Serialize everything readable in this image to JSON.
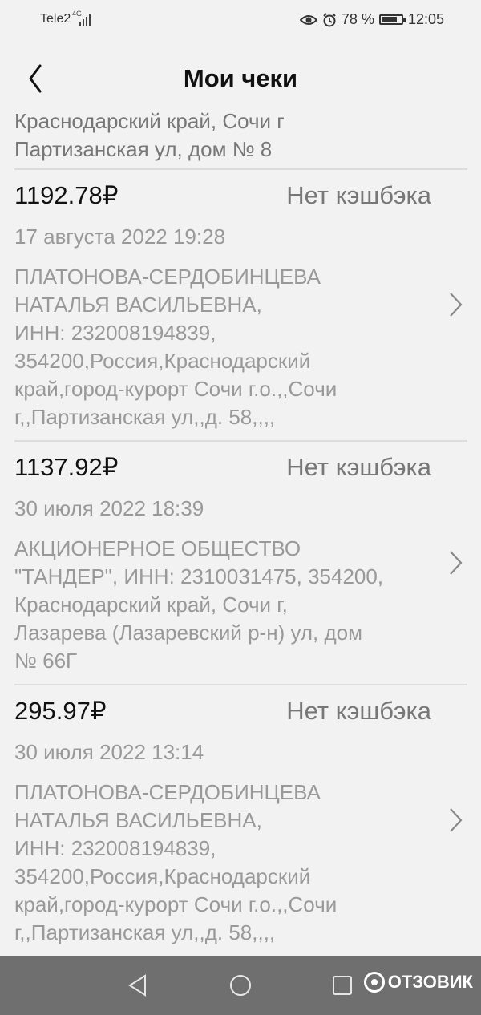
{
  "status_bar": {
    "carrier": "Tele2",
    "network": "4G",
    "battery": "78 %",
    "battery_level": 0.78,
    "time": "12:05"
  },
  "header": {
    "title": "Мои чеки"
  },
  "partial_top": "Краснодарский край, Сочи г\nПартизанская ул, дом № 8",
  "receipts": [
    {
      "amount": "1192.78₽",
      "cashback": "Нет кэшбэка",
      "date": "17 августа 2022 19:28",
      "seller": "ПЛАТОНОВА-СЕРДОБИНЦЕВА\nНАТАЛЬЯ ВАСИЛЬЕВНА,\nИНН: 232008194839,\n354200,Россия,Краснодарский\nкрай,город-курорт Сочи г.о.,,Сочи\nг,,Партизанская ул,,д. 58,,,,"
    },
    {
      "amount": "1137.92₽",
      "cashback": "Нет кэшбэка",
      "date": "30 июля 2022 18:39",
      "seller": "АКЦИОНЕРНОЕ ОБЩЕСТВО\n\"ТАНДЕР\", ИНН: 2310031475, 354200,\nКраснодарский край, Сочи г,\nЛазарева (Лазаревский р-н) ул, дом\n№ 66Г"
    },
    {
      "amount": "295.97₽",
      "cashback": "Нет кэшбэка",
      "date": "30 июля 2022 13:14",
      "seller": "ПЛАТОНОВА-СЕРДОБИНЦЕВА\nНАТАЛЬЯ ВАСИЛЬЕВНА,\nИНН: 232008194839,\n354200,Россия,Краснодарский\nкрай,город-курорт Сочи г.о.,,Сочи\nг,,Партизанская ул,,д. 58,,,,"
    }
  ],
  "watermark": "ОТЗОВИК",
  "icons": [
    "back-icon",
    "chevron-right-icon",
    "eye-icon",
    "alarm-icon",
    "battery-icon",
    "signal-icon",
    "nav-back-icon",
    "nav-home-icon",
    "nav-recents-icon"
  ]
}
